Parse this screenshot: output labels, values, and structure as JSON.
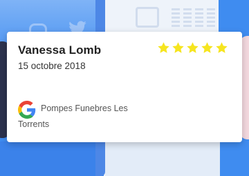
{
  "review": {
    "reviewer_name": "Vanessa Lomb",
    "date": "15 octobre 2018",
    "rating": 5,
    "max_rating": 5,
    "star_color": "#f6e51f",
    "business_name": "Pompes Funebres Les Torrents",
    "source_icon": "google-icon"
  },
  "background": {
    "icons": [
      "instagram-icon",
      "twitter-icon",
      "twitch-icon"
    ],
    "accent_color": "#3f8cf0"
  }
}
